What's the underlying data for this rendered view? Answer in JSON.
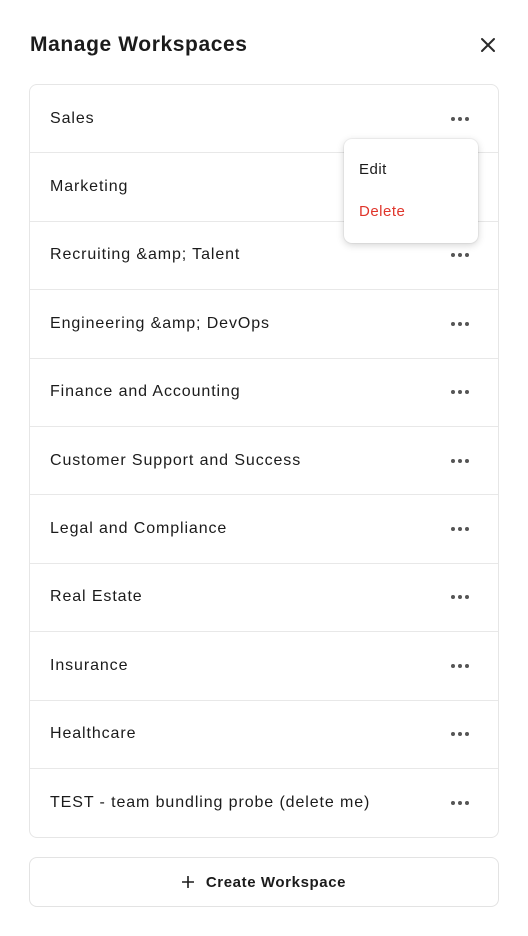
{
  "modal": {
    "title": "Manage Workspaces",
    "close_icon": "close-icon"
  },
  "workspaces": [
    {
      "label": "Sales"
    },
    {
      "label": "Marketing"
    },
    {
      "label": "Recruiting &amp; Talent"
    },
    {
      "label": "Engineering &amp; DevOps"
    },
    {
      "label": "Finance and Accounting"
    },
    {
      "label": "Customer Support and Success"
    },
    {
      "label": "Legal and Compliance"
    },
    {
      "label": "Real Estate"
    },
    {
      "label": "Insurance"
    },
    {
      "label": "Healthcare"
    },
    {
      "label": "TEST - team bundling probe (delete me)"
    }
  ],
  "context_menu": {
    "edit_label": "Edit",
    "delete_label": "Delete",
    "delete_color": "#e0352b"
  },
  "create_button": {
    "label": "Create Workspace",
    "icon": "plus-icon"
  }
}
